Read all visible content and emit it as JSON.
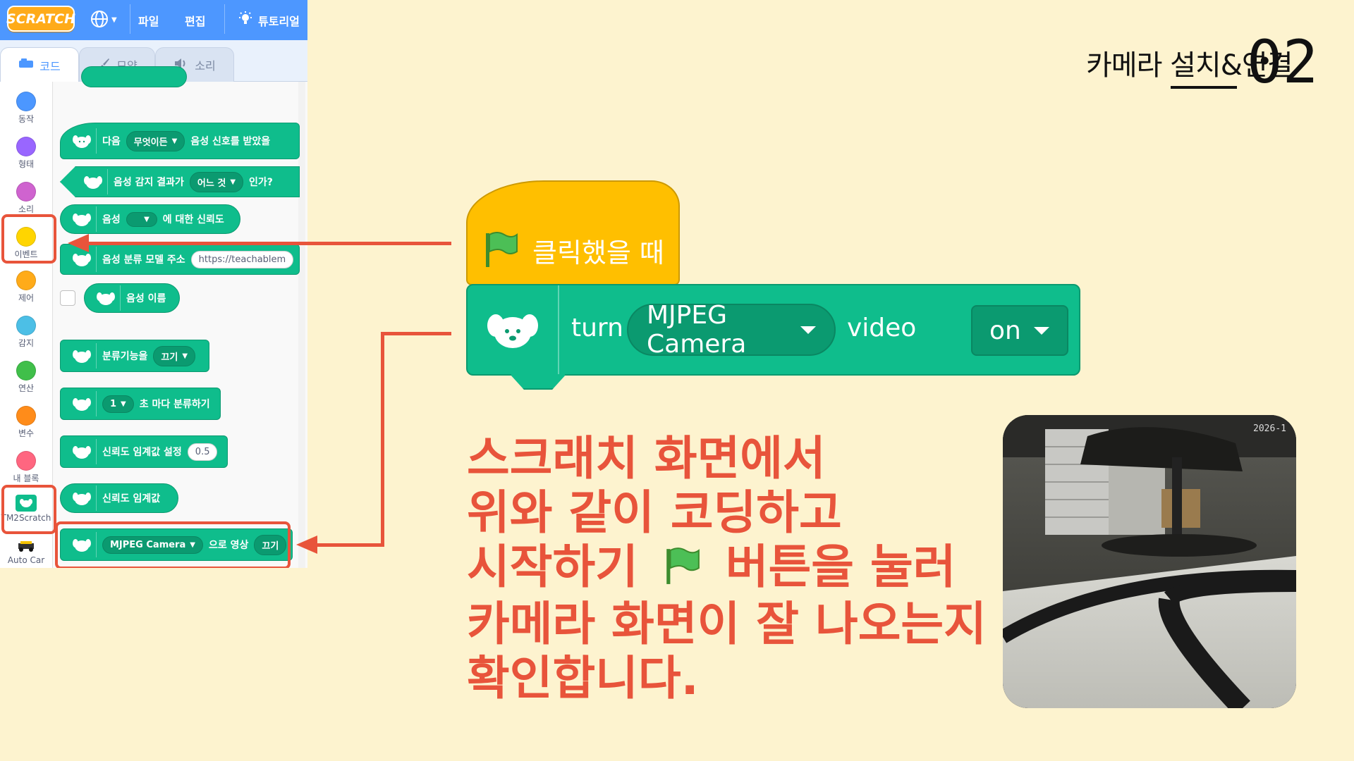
{
  "slide": {
    "title": "카메라 설치&연결",
    "page_number": "02"
  },
  "scratch": {
    "logo": "SCRATCH",
    "menu": {
      "file": "파일",
      "edit": "편집",
      "tutorials": "튜토리얼"
    },
    "tabs": {
      "code": "코드",
      "costumes": "모양",
      "sounds": "소리"
    },
    "categories": [
      {
        "label": "동작",
        "color": "#4c97ff"
      },
      {
        "label": "형태",
        "color": "#9966ff"
      },
      {
        "label": "소리",
        "color": "#cf63cf"
      },
      {
        "label": "이벤트",
        "color": "#ffd500"
      },
      {
        "label": "제어",
        "color": "#ffab19"
      },
      {
        "label": "감지",
        "color": "#4cbfe6"
      },
      {
        "label": "연산",
        "color": "#40bf4a"
      },
      {
        "label": "변수",
        "color": "#ff8c1a"
      },
      {
        "label": "내 블록",
        "color": "#ff6680"
      },
      {
        "label": "TM2Scratch",
        "color": "#0fbd8c"
      },
      {
        "label": "Auto Car",
        "color": "#ffffff"
      }
    ],
    "blocks": {
      "b1": {
        "pre": "다음",
        "drop": "무엇이든",
        "post": "음성 신호를 받았을"
      },
      "b2": {
        "pre": "음성 감지 결과가",
        "drop": "어느 것",
        "post": "인가?"
      },
      "b3": {
        "pre": "음성",
        "drop": "",
        "post": "에 대한 신뢰도"
      },
      "b4": {
        "pre": "음성 분류 모델 주소",
        "input": "https://teachablem"
      },
      "b5": {
        "label": "음성 이름"
      },
      "b6": {
        "pre": "분류기능을",
        "drop": "끄기"
      },
      "b7": {
        "drop": "1",
        "post": "초 마다 분류하기"
      },
      "b8": {
        "pre": "신뢰도 임계값 설정",
        "input": "0.5"
      },
      "b9": {
        "label": "신뢰도 임계값"
      },
      "b10": {
        "drop": "MJPEG Camera",
        "post": "으로 영상",
        "drop2": "끄기"
      }
    }
  },
  "code": {
    "hat_label": "클릭했을 때",
    "cam_block": {
      "turn": "turn",
      "camera": "MJPEG Camera",
      "video": "video",
      "state": "on"
    }
  },
  "instructions": [
    "스크래치 화면에서",
    "위와 같이 코딩하고",
    "시작하기",
    "버튼을 눌러",
    "카메라 화면이 잘 나오는지",
    "확인합니다."
  ],
  "camera_preview": {
    "timestamp": "2026-1"
  },
  "colors": {
    "accent": "#e8543b",
    "scratch_blue": "#4d97ff",
    "extension_green": "#0fbd8c",
    "event_yellow": "#ffbf00"
  }
}
